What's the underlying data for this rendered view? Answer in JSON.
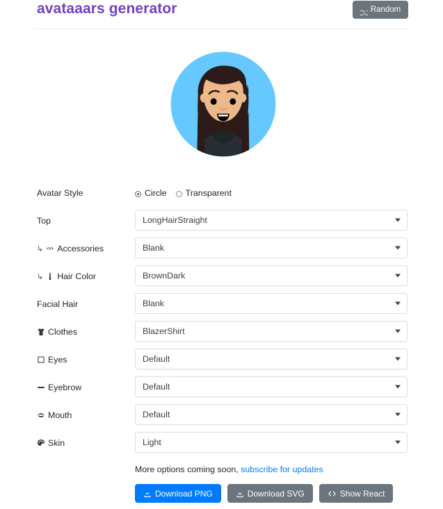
{
  "header": {
    "title": "avataaars generator",
    "random_button": {
      "label": "Random",
      "icon": "shuffle-icon"
    },
    "title_color": "#6f42c1"
  },
  "avatar": {
    "style": "Circle",
    "background_color": "#65C9FF",
    "hair_color": "#2C1B18",
    "skin_color": "#EDB98A",
    "clothes_color": "#262E33",
    "eyes_color": "#000000",
    "mouth_color": "#000000"
  },
  "form": {
    "avatar_style": {
      "label": "Avatar Style",
      "options": [
        "Circle",
        "Transparent"
      ],
      "selected": "Circle"
    },
    "fields": [
      {
        "label": "Top",
        "icon": "",
        "sub": false,
        "value": "LongHairStraight"
      },
      {
        "label": "Accessories",
        "icon": "glasses-icon",
        "sub": true,
        "value": "Blank"
      },
      {
        "label": "Hair Color",
        "icon": "hair-color-icon",
        "sub": true,
        "value": "BrownDark"
      },
      {
        "label": "Facial Hair",
        "icon": "",
        "sub": false,
        "value": "Blank"
      },
      {
        "label": "Clothes",
        "icon": "tshirt-icon",
        "sub": false,
        "value": "BlazerShirt"
      },
      {
        "label": "Eyes",
        "icon": "eye-icon",
        "sub": false,
        "value": "Default"
      },
      {
        "label": "Eyebrow",
        "icon": "eyebrow-icon",
        "sub": false,
        "value": "Default"
      },
      {
        "label": "Mouth",
        "icon": "mouth-icon",
        "sub": false,
        "value": "Default"
      },
      {
        "label": "Skin",
        "icon": "palette-icon",
        "sub": false,
        "value": "Light"
      }
    ]
  },
  "footer": {
    "note_text": "More options coming soon, ",
    "note_link": "subscribe for updates",
    "buttons": [
      {
        "label": "Download PNG",
        "icon": "download-icon",
        "style": "primary",
        "color": "#007bff"
      },
      {
        "label": "Download SVG",
        "icon": "download-icon",
        "style": "secondary",
        "color": "#6c757d"
      },
      {
        "label": "Show React",
        "icon": "code-icon",
        "style": "secondary",
        "color": "#6c757d"
      }
    ]
  }
}
